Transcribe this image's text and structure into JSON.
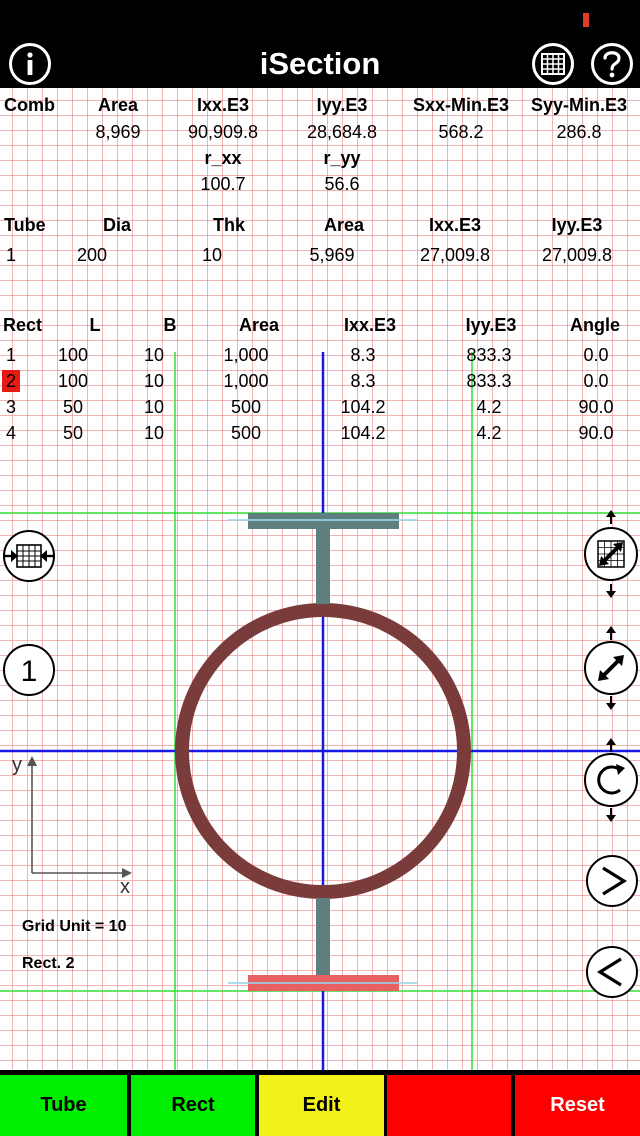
{
  "nav": {
    "title": "iSection",
    "info_icon": "info-icon",
    "grid_icon": "grid-icon",
    "help_icon": "help-icon"
  },
  "comb": {
    "headers": [
      "Comb",
      "Area",
      "Ixx.E3",
      "Iyy.E3",
      "Sxx-Min.E3",
      "Syy-Min.E3"
    ],
    "values": [
      "8,969",
      "90,909.8",
      "28,684.8",
      "568.2",
      "286.8"
    ],
    "r_headers": [
      "r_xx",
      "r_yy"
    ],
    "r_values": [
      "100.7",
      "56.6"
    ]
  },
  "tube": {
    "headers": [
      "Tube",
      "Dia",
      "Thk",
      "Area",
      "Ixx.E3",
      "Iyy.E3"
    ],
    "row": [
      "1",
      "200",
      "10",
      "5,969",
      "27,009.8",
      "27,009.8"
    ]
  },
  "rect": {
    "headers": [
      "Rect",
      "L",
      "B",
      "Area",
      "Ixx.E3",
      "Iyy.E3",
      "Angle"
    ],
    "rows": [
      [
        "1",
        "100",
        "10",
        "1,000",
        "8.3",
        "833.3",
        "0.0"
      ],
      [
        "2",
        "100",
        "10",
        "1,000",
        "8.3",
        "833.3",
        "0.0"
      ],
      [
        "3",
        "50",
        "10",
        "500",
        "104.2",
        "4.2",
        "90.0"
      ],
      [
        "4",
        "50",
        "10",
        "500",
        "104.2",
        "4.2",
        "90.0"
      ]
    ],
    "selected_index": 1
  },
  "canvas": {
    "axis_y_label": "y",
    "axis_x_label": "x",
    "grid_unit_label": "Grid Unit = 10",
    "selection_label": "Rect. 2",
    "layer_number": "1"
  },
  "colors": {
    "grid": "#e67878",
    "tube": "#7a3b3b",
    "rect_normal": "#5f7f7f",
    "rect_selected": "#e86060",
    "green_line": "#33dd33",
    "blue_axis": "#1a1ae6",
    "accent_green": "#00ee00",
    "accent_yellow": "#f2f21a",
    "accent_red": "#ff0000"
  },
  "controls": {
    "left": [
      "fit-width-icon",
      "layer-number-icon"
    ],
    "right": [
      "resize-rect-icon",
      "move-diagonal-icon",
      "rotate-icon",
      "next-icon",
      "previous-icon"
    ]
  },
  "tabs": [
    {
      "label": "Tube",
      "color": "#00ee00"
    },
    {
      "label": "Rect",
      "color": "#00ee00"
    },
    {
      "label": "Edit",
      "color": "#f2f21a"
    },
    {
      "label": "",
      "color": "#ff0000"
    },
    {
      "label": "Reset",
      "color": "#ff0000"
    }
  ]
}
